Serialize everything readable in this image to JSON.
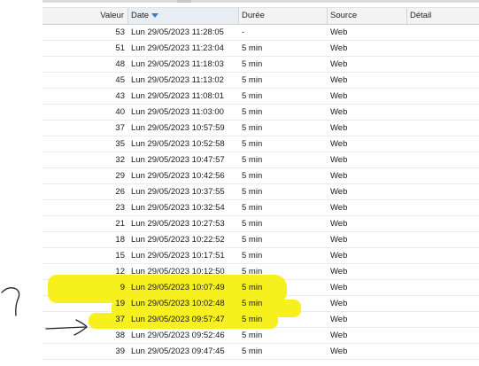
{
  "columns": {
    "valeur": "Valeur",
    "date": "Date",
    "duree": "Durée",
    "source": "Source",
    "detail": "Détail"
  },
  "sort": {
    "column": "date",
    "icon": "sort-desc-icon"
  },
  "rows": [
    {
      "valeur": "53",
      "date": "Lun 29/05/2023 11:28:05",
      "duree": "-",
      "source": "Web",
      "detail": ""
    },
    {
      "valeur": "51",
      "date": "Lun 29/05/2023 11:23:04",
      "duree": "5 min",
      "source": "Web",
      "detail": ""
    },
    {
      "valeur": "48",
      "date": "Lun 29/05/2023 11:18:03",
      "duree": "5 min",
      "source": "Web",
      "detail": ""
    },
    {
      "valeur": "45",
      "date": "Lun 29/05/2023 11:13:02",
      "duree": "5 min",
      "source": "Web",
      "detail": ""
    },
    {
      "valeur": "43",
      "date": "Lun 29/05/2023 11:08:01",
      "duree": "5 min",
      "source": "Web",
      "detail": ""
    },
    {
      "valeur": "40",
      "date": "Lun 29/05/2023 11:03:00",
      "duree": "5 min",
      "source": "Web",
      "detail": ""
    },
    {
      "valeur": "37",
      "date": "Lun 29/05/2023 10:57:59",
      "duree": "5 min",
      "source": "Web",
      "detail": ""
    },
    {
      "valeur": "35",
      "date": "Lun 29/05/2023 10:52:58",
      "duree": "5 min",
      "source": "Web",
      "detail": ""
    },
    {
      "valeur": "32",
      "date": "Lun 29/05/2023 10:47:57",
      "duree": "5 min",
      "source": "Web",
      "detail": ""
    },
    {
      "valeur": "29",
      "date": "Lun 29/05/2023 10:42:56",
      "duree": "5 min",
      "source": "Web",
      "detail": ""
    },
    {
      "valeur": "26",
      "date": "Lun 29/05/2023 10:37:55",
      "duree": "5 min",
      "source": "Web",
      "detail": ""
    },
    {
      "valeur": "23",
      "date": "Lun 29/05/2023 10:32:54",
      "duree": "5 min",
      "source": "Web",
      "detail": ""
    },
    {
      "valeur": "21",
      "date": "Lun 29/05/2023 10:27:53",
      "duree": "5 min",
      "source": "Web",
      "detail": ""
    },
    {
      "valeur": "18",
      "date": "Lun 29/05/2023 10:22:52",
      "duree": "5 min",
      "source": "Web",
      "detail": ""
    },
    {
      "valeur": "15",
      "date": "Lun 29/05/2023 10:17:51",
      "duree": "5 min",
      "source": "Web",
      "detail": ""
    },
    {
      "valeur": "12",
      "date": "Lun 29/05/2023 10:12:50",
      "duree": "5 min",
      "source": "Web",
      "detail": ""
    },
    {
      "valeur": "9",
      "date": "Lun 29/05/2023 10:07:49",
      "duree": "5 min",
      "source": "Web",
      "detail": ""
    },
    {
      "valeur": "19",
      "date": "Lun 29/05/2023 10:02:48",
      "duree": "5 min",
      "source": "Web",
      "detail": ""
    },
    {
      "valeur": "37",
      "date": "Lun 29/05/2023 09:57:47",
      "duree": "5 min",
      "source": "Web",
      "detail": ""
    },
    {
      "valeur": "38",
      "date": "Lun 29/05/2023 09:52:46",
      "duree": "5 min",
      "source": "Web",
      "detail": ""
    },
    {
      "valeur": "39",
      "date": "Lun 29/05/2023 09:47:45",
      "duree": "5 min",
      "source": "Web",
      "detail": ""
    }
  ],
  "annotations": {
    "highlight_color": "#f6f11e",
    "question_mark": "?",
    "arrow_icon": "hand-drawn-arrow-icon"
  }
}
